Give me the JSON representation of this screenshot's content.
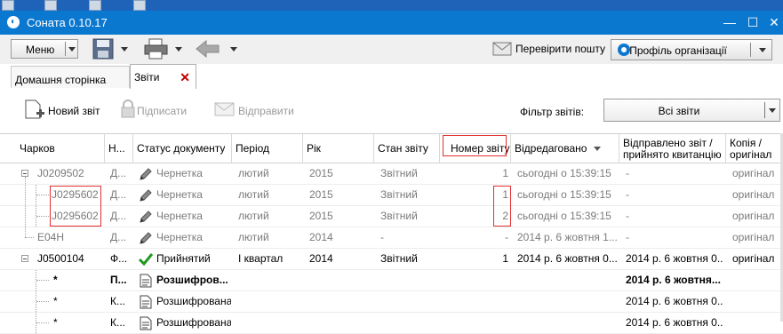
{
  "window": {
    "title": "Соната 0.10.17"
  },
  "toolbar": {
    "menu_label": "Меню",
    "check_mail_label": "Перевірити пошту",
    "profile_label": "Профіль організації"
  },
  "tabs": [
    {
      "label": "Домашня сторінка",
      "active": false
    },
    {
      "label": "Звіти",
      "active": true
    }
  ],
  "actions": {
    "new_report": "Новий звіт",
    "sign": "Підписати",
    "send": "Відправити",
    "filter_label": "Фільтр звітів:",
    "filter_value": "Всі звіти"
  },
  "columns": {
    "code": "Чарков",
    "n": "Н...",
    "status": "Статус документу",
    "period": "Період",
    "year": "Рік",
    "state": "Стан звіту",
    "report_no": "Номер звіту",
    "edited": "Відредаговано",
    "sent": "Відправлено звіт / прийнято квитанцію",
    "copy": "Копія / оригінал"
  },
  "rows": [
    {
      "code": "J0209502",
      "n": "Д...",
      "status": "Чернетка",
      "status_icon": "pencil-icon",
      "period": "лютий",
      "year": "2015",
      "state": "Звітний",
      "report_no": "1",
      "edited": "сьогодні о 15:39:15",
      "sent": "-",
      "copy": "оригінал",
      "style": "grey",
      "level": 0
    },
    {
      "code": "J0295602",
      "n": "Д...",
      "status": "Чернетка",
      "status_icon": "pencil-icon",
      "period": "лютий",
      "year": "2015",
      "state": "Звітний",
      "report_no": "1",
      "edited": "сьогодні о 15:39:15",
      "sent": "-",
      "copy": "оригінал",
      "style": "grey",
      "level": 1
    },
    {
      "code": "J0295602",
      "n": "Д...",
      "status": "Чернетка",
      "status_icon": "pencil-icon",
      "period": "лютий",
      "year": "2015",
      "state": "Звітний",
      "report_no": "2",
      "edited": "сьогодні о 15:39:15",
      "sent": "-",
      "copy": "оригінал",
      "style": "grey",
      "level": 1
    },
    {
      "code": "E04H",
      "n": "Д...",
      "status": "Чернетка",
      "status_icon": "pencil-icon",
      "period": "лютий",
      "year": "2014",
      "state": "-",
      "report_no": "-",
      "edited": "2014 р. 6 жовтня 1...",
      "sent": "-",
      "copy": "оригінал",
      "style": "grey",
      "level": 0
    },
    {
      "code": "J0500104",
      "n": "Ф...",
      "status": "Прийнятий",
      "status_icon": "check-icon",
      "period": "I квартал",
      "year": "2014",
      "state": "Звітний",
      "report_no": "1",
      "edited": "2014 р. 6 жовтня 0...",
      "sent": "2014 р. 6 жовтня 0...",
      "copy": "оригінал",
      "style": "normal",
      "level": 0
    },
    {
      "code": "*",
      "n": "П...",
      "status": "Розшифров...",
      "status_icon": "document-icon",
      "period": "",
      "year": "",
      "state": "",
      "report_no": "",
      "edited": "",
      "sent": "2014 р. 6 жовтня...",
      "copy": "",
      "style": "bold",
      "level": 1
    },
    {
      "code": "*",
      "n": "К...",
      "status": "Розшифрована",
      "status_icon": "document-icon",
      "period": "",
      "year": "",
      "state": "",
      "report_no": "",
      "edited": "",
      "sent": "2014 р. 6 жовтня 0...",
      "copy": "",
      "style": "normal",
      "level": 1
    },
    {
      "code": "*",
      "n": "К...",
      "status": "Розшифрована",
      "status_icon": "document-icon",
      "period": "",
      "year": "",
      "state": "",
      "report_no": "",
      "edited": "",
      "sent": "2014 р. 6 жовтня 0...",
      "copy": "",
      "style": "normal",
      "level": 1
    }
  ]
}
